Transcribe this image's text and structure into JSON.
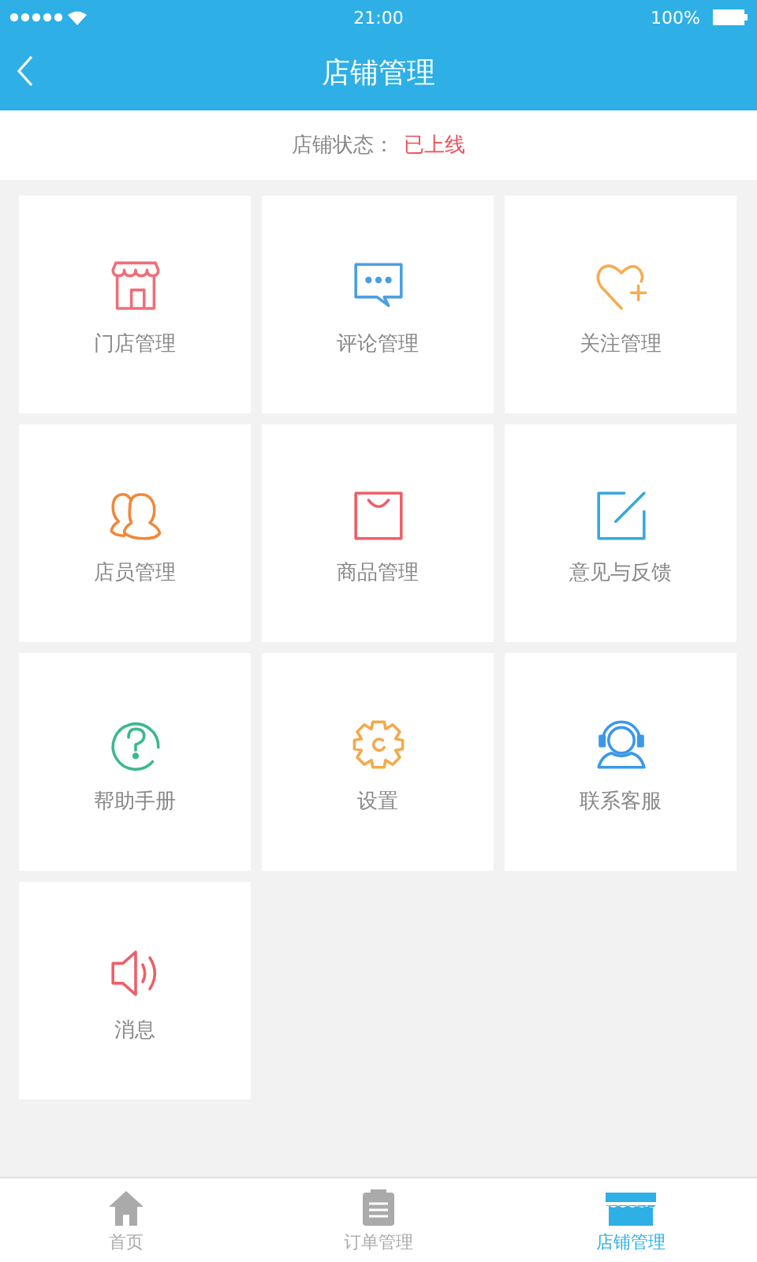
{
  "status_bar": {
    "time": "21:00",
    "battery": "100%"
  },
  "nav_bar": {
    "title": "店铺管理"
  },
  "store_status": {
    "label": "店铺状态：",
    "value": "已上线"
  },
  "tiles": [
    {
      "label": "门店管理",
      "kind": "store",
      "color": "#ee6f78"
    },
    {
      "label": "评论管理",
      "kind": "chat",
      "color": "#4a9fe2"
    },
    {
      "label": "关注管理",
      "kind": "heart",
      "color": "#f4ad52"
    },
    {
      "label": "店员管理",
      "kind": "people",
      "color": "#f0883c"
    },
    {
      "label": "商品管理",
      "kind": "bag",
      "color": "#ee5f68"
    },
    {
      "label": "意见与反馈",
      "kind": "edit",
      "color": "#37a8de"
    },
    {
      "label": "帮助手册",
      "kind": "help",
      "color": "#3bb98c"
    },
    {
      "label": "设置",
      "kind": "gear",
      "color": "#f4a94a"
    },
    {
      "label": "联系客服",
      "kind": "service",
      "color": "#3b98e8"
    },
    {
      "label": "消息",
      "kind": "speaker",
      "color": "#ee5f68"
    }
  ],
  "tab_bar": [
    {
      "label": "首页",
      "kind": "home",
      "selected": false
    },
    {
      "label": "订单管理",
      "kind": "orders",
      "selected": false
    },
    {
      "label": "店铺管理",
      "kind": "shop",
      "selected": true
    }
  ]
}
